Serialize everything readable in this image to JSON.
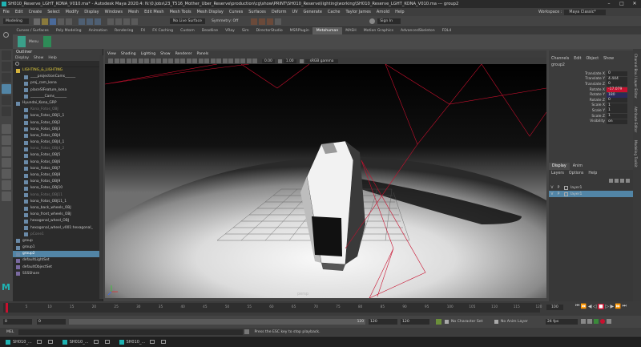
{
  "window": {
    "title": "SH010_Reserve_LGHT_KONA_V010.ma* - Autodesk Maya 2020.4: N:\\0.Jobs\\23_T516_Mother_Uber_Reserve\\production\\cg\\show\\PRINT\\SH010_Reserve\\lighting\\working\\SH010_Reserve_LGHT_KONA_V010.ma   ---   group2"
  },
  "menubar": [
    "File",
    "Edit",
    "Create",
    "Select",
    "Modify",
    "Display",
    "Windows",
    "Mesh",
    "Edit Mesh",
    "Mesh Tools",
    "Mesh Display",
    "Curves",
    "Surfaces",
    "Deform",
    "UV",
    "Generate",
    "Cache",
    "Taylor James",
    "Arnold",
    "Help"
  ],
  "workspace": {
    "label": "Workspace :",
    "value": "Maya Classic*"
  },
  "status": {
    "mode": "Modeling",
    "live_surface": "No Live Surface",
    "symmetry": "Symmetry: Off",
    "sign_in": "Sign In"
  },
  "shelf_tabs": [
    "Curves / Surfaces",
    "Poly Modeling",
    "Animation",
    "Rendering",
    "FX",
    "FX Caching",
    "Custom",
    "Deadline",
    "VRay",
    "Sim",
    "DirectorStudio",
    "MSRPlugin",
    "Metahuman",
    "MASH",
    "Motion Graphics",
    "AdvancedSkeleton",
    "FDL4"
  ],
  "shelf_active": "Metahuman",
  "shelf_menu_label": "Menu",
  "outliner": {
    "title": "Outliner",
    "menu": [
      "Display",
      "Show",
      "Help"
    ],
    "items": [
      "LIGHTING_&_LIGHTING",
      "____projectionCams______",
      "proj_cam_kona",
      "placeSlFeature_kona",
      "________Cams_______",
      "Hyundai_Kona_GRP",
      "Kona_Fotos_OBJ",
      "kona_Fotos_OBJ1_1",
      "kona_Fotos_OBJ2",
      "kona_Fotos_OBJ3",
      "kona_Fotos_OBJ4",
      "kona_Fotos_OBJ4_1",
      "kona_Fotos_OBJ4_2",
      "kona_Fotos_OBJ5",
      "kona_Fotos_OBJ6",
      "kona_Fotos_OBJ7",
      "kona_Fotos_OBJ8",
      "kona_Fotos_OBJ9",
      "kona_Fotos_OBJ10",
      "kona_Fotos_OBJ11",
      "kona_Fotos_OBJ11_1",
      "kona_back_wheels_OBJ",
      "kona_front_wheels_OBJ",
      "hexagonal_wheel_OBJ",
      "hexagonal_wheel_v001:hexagonal_",
      "pCone1",
      "group",
      "group1",
      "group2",
      "defaultLightSet",
      "defaultObjectSet",
      "SSSShare"
    ],
    "selected": "group2"
  },
  "viewport": {
    "menu": [
      "View",
      "Shading",
      "Lighting",
      "Show",
      "Renderer",
      "Panels"
    ],
    "exposure": "0.00",
    "gamma": "1.00",
    "colorspace": "sRGB gamma",
    "hud_text": "persp"
  },
  "channelbox": {
    "menu": [
      "Channels",
      "Edit",
      "Object",
      "Show"
    ],
    "object": "group2",
    "attributes": [
      {
        "name": "Translate X",
        "value": "0"
      },
      {
        "name": "Translate Y",
        "value": "4.444"
      },
      {
        "name": "Translate Z",
        "value": "0"
      },
      {
        "name": "Rotate X",
        "value": "-17.079"
      },
      {
        "name": "Rotate Y",
        "value": "180"
      },
      {
        "name": "Rotate Z",
        "value": "0"
      },
      {
        "name": "Scale X",
        "value": "1"
      },
      {
        "name": "Scale Y",
        "value": "1"
      },
      {
        "name": "Scale Z",
        "value": "1"
      },
      {
        "name": "Visibility",
        "value": "on"
      }
    ],
    "side_tabs": [
      "Channel Box / Layer Editor",
      "Attribute Editor",
      "Modeling Toolkit"
    ]
  },
  "layers": {
    "tabs": [
      "Display",
      "Anim"
    ],
    "menu": [
      "Layers",
      "Options",
      "Help"
    ],
    "rows": [
      {
        "v": "V",
        "p": "P",
        "name": "layer1"
      },
      {
        "v": "V",
        "p": "P",
        "name": "layer1"
      }
    ]
  },
  "timeline": {
    "ticks": [
      "5",
      "10",
      "15",
      "20",
      "25",
      "30",
      "35",
      "40",
      "45",
      "50",
      "55",
      "60",
      "65",
      "70",
      "75",
      "80",
      "85",
      "90",
      "95",
      "100",
      "105",
      "110",
      "115",
      "120"
    ],
    "current_frame": "100"
  },
  "range": {
    "start": "0",
    "inner_start": "0",
    "inner_end": "120",
    "end": "120",
    "end2": "120",
    "character_set": "No Character Set",
    "anim_layer": "No Anim Layer",
    "fps": "24 fps"
  },
  "cmdline": {
    "label": "MEL",
    "help": "Press the ESC key to stop playback."
  },
  "taskbar": {
    "items": [
      {
        "icon": "maya-icon",
        "label": "SH010_..."
      },
      {
        "icon": "window-icon",
        "label": ""
      },
      {
        "icon": "window-icon",
        "label": ""
      },
      {
        "icon": "maya-icon",
        "label": "SH010_..."
      },
      {
        "icon": "window-icon",
        "label": ""
      },
      {
        "icon": "window-icon",
        "label": ""
      },
      {
        "icon": "maya-icon",
        "label": "SH010_..."
      },
      {
        "icon": "window-icon",
        "label": ""
      },
      {
        "icon": "window-icon",
        "label": ""
      }
    ]
  },
  "colors": {
    "accent": "#5285a6",
    "selection_red": "#c8102e",
    "maya_teal": "#1fb3b3"
  }
}
